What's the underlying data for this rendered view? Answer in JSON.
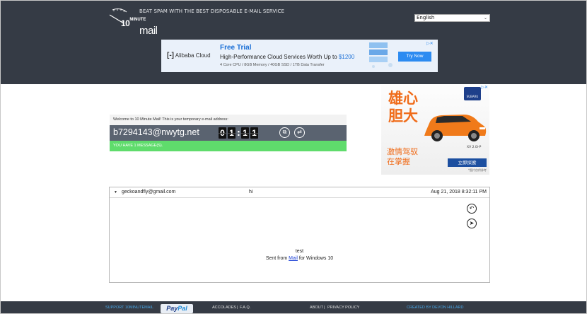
{
  "header": {
    "logo": {
      "num": "10",
      "minute": "MINUTE",
      "mail": "mail"
    },
    "tagline": "BEAT SPAM WITH THE BEST DISPOSABLE E-MAIL SERVICE",
    "language": {
      "selected": "English"
    }
  },
  "banner_ad": {
    "brand": "Alibaba Cloud",
    "title": "Free Trial",
    "headline": "High-Performance Cloud Services Worth Up to ",
    "price": "$1200",
    "specs": "4 Core CPU / 8GB Memory / 40GB SSD / 1TB Data Transfer",
    "button": "Try Now"
  },
  "side_ad": {
    "line1": "雄心",
    "line2": "胆大",
    "promo1": "激情驾驭",
    "promo2": "在掌握",
    "model": "XV 2.0i-P",
    "brand": "SUBARU",
    "cta": "立即探索",
    "fine": "*图片仅供参考"
  },
  "mailbox": {
    "welcome": "Welcome to 10 Minute Mail! This is your temporary e-mail address:",
    "address": "b7294143@nwytg.net",
    "timer": {
      "d1": "0",
      "d2": "1",
      "d3": "1",
      "d4": "1"
    },
    "status": "YOU HAVE 1 MESSAGE(S)."
  },
  "message": {
    "from": "geckoandfly@gmail.com",
    "subject": "hi",
    "date": "Aug 21, 2018 8:32:11 PM",
    "body_line1": "test",
    "sent_prefix": "Sent from ",
    "sent_link": "Mail",
    "sent_suffix": " for Windows 10"
  },
  "footer": {
    "support": "SUPPORT 10MINUTEMAIL",
    "paypal_a": "Pay",
    "paypal_b": "Pal",
    "accolades": "ACCOLADES",
    "faq": "F.A.Q.",
    "about": "ABOUT",
    "privacy": "PRIVACY POLICY",
    "created_by": "CREATED BY DEVON HILLARD",
    "sep": "|"
  },
  "icons": [
    "refresh-icon",
    "copy-icon",
    "reply-icon",
    "forward-icon",
    "chevron-down-icon",
    "ad-close-icon"
  ]
}
